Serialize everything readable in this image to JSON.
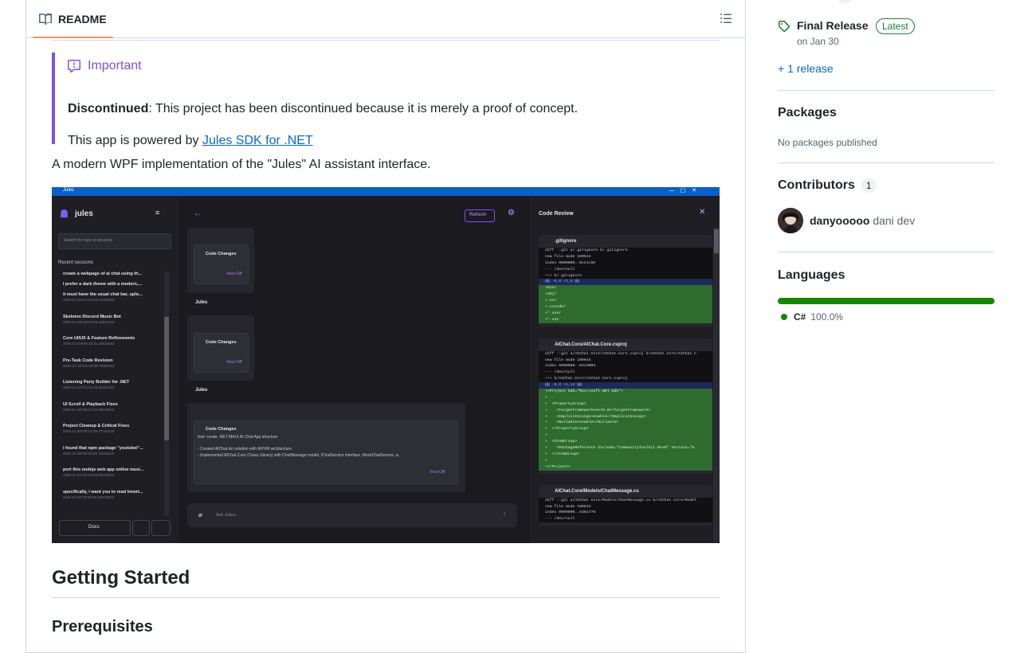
{
  "readme": {
    "tab_label": "README",
    "alert": {
      "title": "Important",
      "p1_strong": "Discontinued",
      "p1_rest": ": This project has been discontinued because it is merely a proof of concept.",
      "p2_text": "This app is powered by ",
      "p2_link": "Jules SDK for .NET"
    },
    "description": "A modern WPF implementation of the \"Jules\" AI assistant interface.",
    "h2": "Getting Started",
    "h3": "Prerequisites"
  },
  "screenshot": {
    "window_title": "Jules",
    "app_name": "jules",
    "search_placeholder": "Search for repo or sessions",
    "recent_label": "Recent sessions",
    "sessions": [
      {
        "title": "create a webpage of ai chat using th...",
        "meta": ""
      },
      {
        "title": "I prefer a dark theme with a modern,...",
        "meta": ""
      },
      {
        "title": "it must have the usual chat bar, uplo...",
        "meta": "2025-01-19T14:42:53.1228485Z"
      },
      {
        "title": "Skeleton Discord Music Bot",
        "meta": "2025-01-08T10:04:55.2381572Z"
      },
      {
        "title": "Core UI/UX & Feature Refinements",
        "meta": "2025-12-16T08:15:31.2981646Z"
      },
      {
        "title": "Pre-Task Code Revision",
        "meta": "2025-12-15T23:34:09.7806846Z"
      },
      {
        "title": "Listening Party Builder for .NET",
        "meta": "2025-12-12T21:41:05.2234122Z"
      },
      {
        "title": "UI Scroll & Playback Fixes",
        "meta": "2025-11-29T18:47:22.0957891Z"
      },
      {
        "title": "Project Cleanup & Critical Fixes",
        "meta": "2025-11-28T08:47:08.0774810Z"
      },
      {
        "title": "i found that npm package \"youtubei\"...",
        "meta": "2025-11-28T05:08:56.1694422Z"
      },
      {
        "title": "port this nodejs web app online musi...",
        "meta": "2025-11-27T19:25:34.9042697Z"
      },
      {
        "title": "specifically, i want you to read innert...",
        "meta": "2025-11-24T23:50:01.6917091Z"
      }
    ],
    "docs_label": "Docs",
    "refresh_label": "Refresh",
    "code_changes": "Code Changes",
    "view_diff": "View Diff",
    "agent_name": "Jules",
    "commit_text": "feat: create .NET MAUI AI Chat App structure",
    "bullet_1": "- Created AIChat.sln solution with MVVM architecture.",
    "bullet_2": "- Implemented AIChat.Core (Class Library) with ChatMessage model, IChatService interface, MockChatService, a...",
    "ask_placeholder": "Ask Julius...",
    "review_title": "Code Review",
    "files": [
      {
        "name": ".gitignore",
        "lines": [
          "diff --git a/.gitignore b/.gitignore",
          "new file mode 100644",
          "index 0000000..0ce1c0e",
          "--- /dev/null",
          "+++ b/.gitignore",
          "@@ -0,0 +1,5 @@",
          "+bin/",
          "+obj/",
          "+.vs/",
          "+.vscode/",
          "+*.user",
          "+*.suo"
        ]
      },
      {
        "name": "AIChat.Core/AIChat.Core.csproj",
        "lines": [
          "diff --git a/AIChat.Core/AIChat.Core.csproj b/AIChat.Core/AIChat.C",
          "new file mode 100644",
          "index 0000000..03c0004",
          "--- /dev/null",
          "+++ b/AIChat.Core/AIChat.Core.csproj",
          "@@ -0,0 +1,14 @@",
          "+<Project Sdk=\"Microsoft.NET.Sdk\">",
          "+",
          "+  <PropertyGroup>",
          "+    <TargetFramework>net8.0</TargetFramework>",
          "+    <ImplicitUsings>enable</ImplicitUsings>",
          "+    <Nullable>enable</Nullable>",
          "+  </PropertyGroup>",
          "+",
          "+  <ItemGroup>",
          "+    <PackageReference Include=\"CommunityToolkit.Mvvm\" Version=\"8.",
          "+  </ItemGroup>",
          "+",
          "+</Project>"
        ]
      },
      {
        "name": "AIChat.Core/Models/ChatMessage.cs",
        "lines": [
          "diff --git a/AIChat.Core/Models/ChatMessage.cs b/AIChat.Core/Model",
          "new file mode 100644",
          "index 0000000..6361776",
          "--- /dev/null"
        ]
      }
    ]
  },
  "sidebar": {
    "release_name": "Final Release",
    "release_badge": "Latest",
    "release_date": "on Jan 30",
    "more_releases": "+ 1 release",
    "packages_title": "Packages",
    "packages_text": "No packages published",
    "contributors_title": "Contributors",
    "contributors_count": "1",
    "contributor_login": "danyooooo",
    "contributor_name": "dani dev",
    "languages_title": "Languages",
    "language_name": "C#",
    "language_percent": "100.0%",
    "language_share": 1.0,
    "language_color": "#178600"
  }
}
